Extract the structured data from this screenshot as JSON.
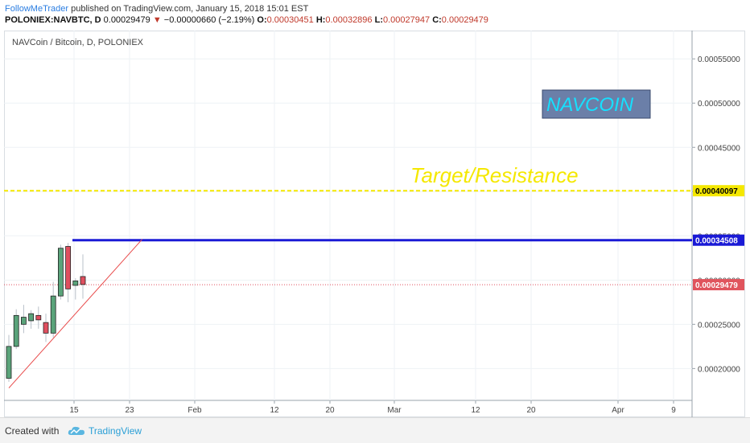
{
  "header": {
    "author": "FollowMeTrader",
    "published": "published on TradingView.com, January 15, 2018 15:01 EST",
    "symbol": "POLONIEX:NAVBTC, D",
    "last": "0.00029479",
    "change": "−0.00000660 (−2.19%)",
    "o_label": "O:",
    "o_value": "0.00030451",
    "h_label": "H:",
    "h_value": "0.00032896",
    "l_label": "L:",
    "l_value": "0.00027947",
    "c_label": "C:",
    "c_value": "0.00029479"
  },
  "footer": {
    "created_with": "Created with",
    "brand": "TradingView"
  },
  "colors": {
    "up": "#5aa37a",
    "down": "#e04f5f",
    "blue_line": "#1a1ad6",
    "yellow_line": "#f5e800",
    "red_trend": "#e84a4a",
    "grid": "#eef2f5",
    "price_label_red": "#e0545d"
  },
  "chart_data": {
    "type": "candlestick",
    "title": "NAVCoin / Bitcoin, D, POLONIEX",
    "x_tick_labels": [
      "15",
      "23",
      "Feb",
      "12",
      "20",
      "Mar",
      "12",
      "20",
      "Apr",
      "9"
    ],
    "y_tick_labels": [
      "0.00020000",
      "0.00025000",
      "0.00030000",
      "0.00035000",
      "0.00040000",
      "0.00045000",
      "0.00050000",
      "0.00055000"
    ],
    "ylim": [
      0.000164,
      0.000582
    ],
    "candles": [
      {
        "o": 0.000189,
        "h": 0.000238,
        "l": 0.000185,
        "c": 0.000225
      },
      {
        "o": 0.000225,
        "h": 0.000267,
        "l": 0.000222,
        "c": 0.00026
      },
      {
        "o": 0.00025,
        "h": 0.000272,
        "l": 0.00024,
        "c": 0.000258
      },
      {
        "o": 0.000254,
        "h": 0.000266,
        "l": 0.000245,
        "c": 0.000262
      },
      {
        "o": 0.00026,
        "h": 0.00027,
        "l": 0.000245,
        "c": 0.000255
      },
      {
        "o": 0.000252,
        "h": 0.000262,
        "l": 0.00023,
        "c": 0.00024
      },
      {
        "o": 0.00024,
        "h": 0.000298,
        "l": 0.000235,
        "c": 0.000282
      },
      {
        "o": 0.000282,
        "h": 0.00034,
        "l": 0.000278,
        "c": 0.000336
      },
      {
        "o": 0.000338,
        "h": 0.000342,
        "l": 0.000275,
        "c": 0.00029
      },
      {
        "o": 0.000294,
        "h": 0.000302,
        "l": 0.000278,
        "c": 0.000299
      },
      {
        "o": 0.000304,
        "h": 0.000329,
        "l": 0.000279,
        "c": 0.000295
      }
    ],
    "horizontal_lines": [
      {
        "value": 0.00040097,
        "label": "0.00040097",
        "style": "dashed",
        "color": "#f5e800"
      },
      {
        "value": 0.00034508,
        "label": "0.00034508",
        "style": "solid",
        "color": "#1a1ad6"
      },
      {
        "value": 0.00029479,
        "label": "0.00029479",
        "style": "dotted",
        "color": "#e04f5f"
      }
    ],
    "annotations": [
      {
        "text": "Target/Resistance",
        "color": "#f5e800"
      },
      {
        "text": "NAVCOIN",
        "color": "#16e0ff",
        "background": "#6b7fa8"
      }
    ],
    "trendline": {
      "from": {
        "candle": 0,
        "value": 0.000178
      },
      "to": {
        "candle": 18,
        "value": 0.000346
      },
      "color": "#e84a4a"
    }
  }
}
